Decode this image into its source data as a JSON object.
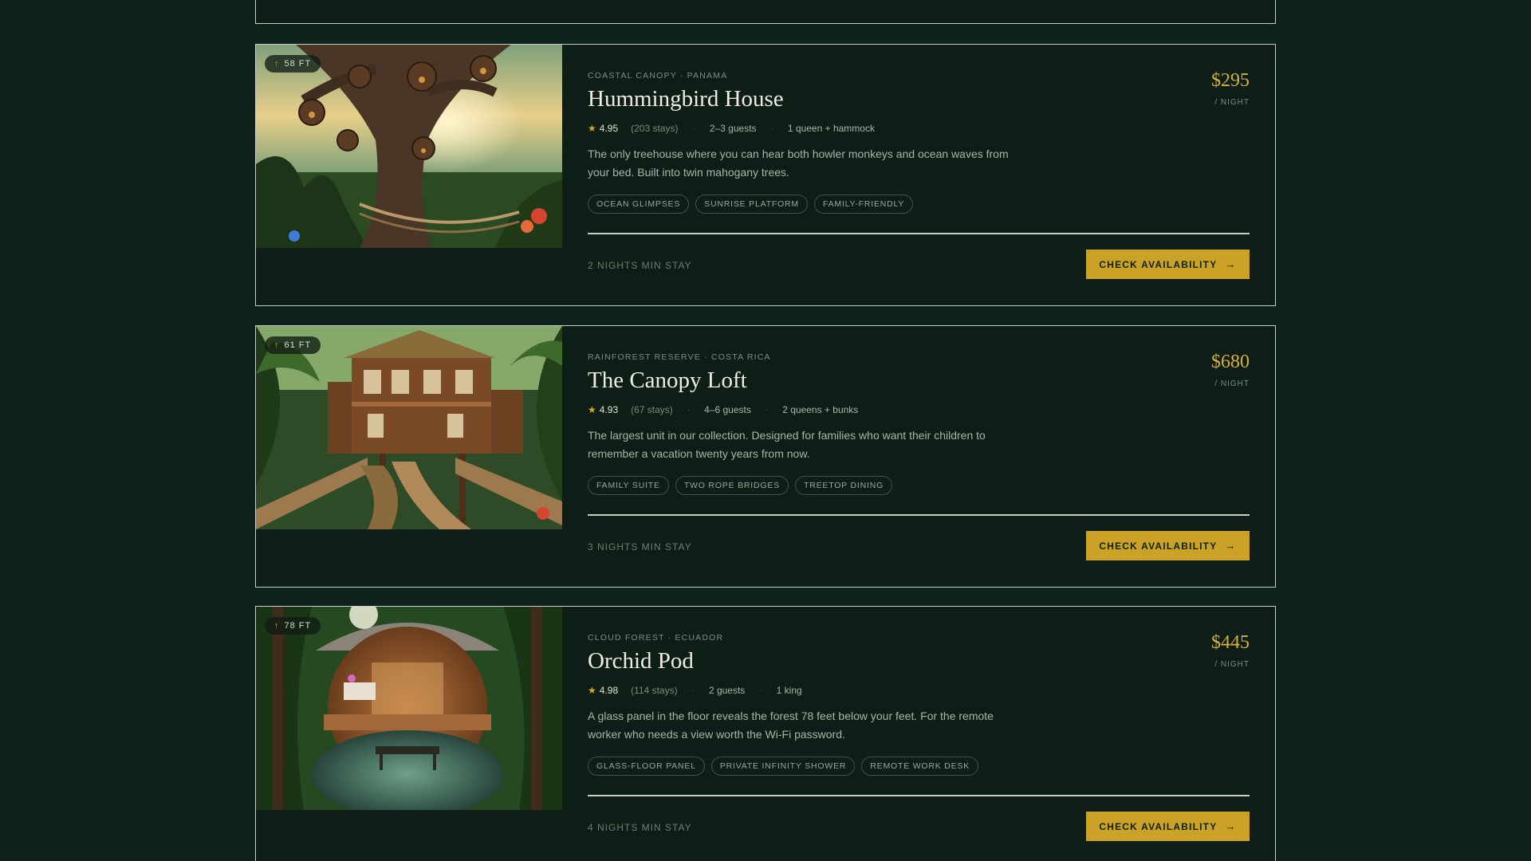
{
  "listings": [
    {
      "height": "58 FT",
      "location": "COASTAL CANOPY · PANAMA",
      "title": "Hummingbird House",
      "rating": "4.95",
      "stays": "(203 stays)",
      "guests": "2–3 guests",
      "beds": "1 queen + hammock",
      "description": "The only treehouse where you can hear both howler monkeys and ocean waves from your bed. Built into twin mahogany trees.",
      "tags": [
        "OCEAN GLIMPSES",
        "SUNRISE PLATFORM",
        "FAMILY-FRIENDLY"
      ],
      "min_stay": "2 NIGHTS MIN STAY",
      "price": "$295",
      "per_night": "/ NIGHT",
      "cta": "CHECK AVAILABILITY"
    },
    {
      "height": "61 FT",
      "location": "RAINFOREST RESERVE · COSTA RICA",
      "title": "The Canopy Loft",
      "rating": "4.93",
      "stays": "(67 stays)",
      "guests": "4–6 guests",
      "beds": "2 queens + bunks",
      "description": "The largest unit in our collection. Designed for families who want their children to remember a vacation twenty years from now.",
      "tags": [
        "FAMILY SUITE",
        "TWO ROPE BRIDGES",
        "TREETOP DINING"
      ],
      "min_stay": "3 NIGHTS MIN STAY",
      "price": "$680",
      "per_night": "/ NIGHT",
      "cta": "CHECK AVAILABILITY"
    },
    {
      "height": "78 FT",
      "location": "CLOUD FOREST · ECUADOR",
      "title": "Orchid Pod",
      "rating": "4.98",
      "stays": "(114 stays)",
      "guests": "2 guests",
      "beds": "1 king",
      "description": "A glass panel in the floor reveals the forest 78 feet below your feet. For the remote worker who needs a view worth the Wi-Fi password.",
      "tags": [
        "GLASS-FLOOR PANEL",
        "PRIVATE INFINITY SHOWER",
        "REMOTE WORK DESK"
      ],
      "min_stay": "4 NIGHTS MIN STAY",
      "price": "$445",
      "per_night": "/ NIGHT",
      "cta": "CHECK AVAILABILITY"
    }
  ],
  "icons": {
    "height": "arrow-up-icon",
    "rating": "star-icon",
    "cta": "arrow-right-icon"
  },
  "colors": {
    "background": "#0d2219",
    "accent": "#c9a227",
    "price": "#d8b13a",
    "border": "#c9cfc8"
  }
}
